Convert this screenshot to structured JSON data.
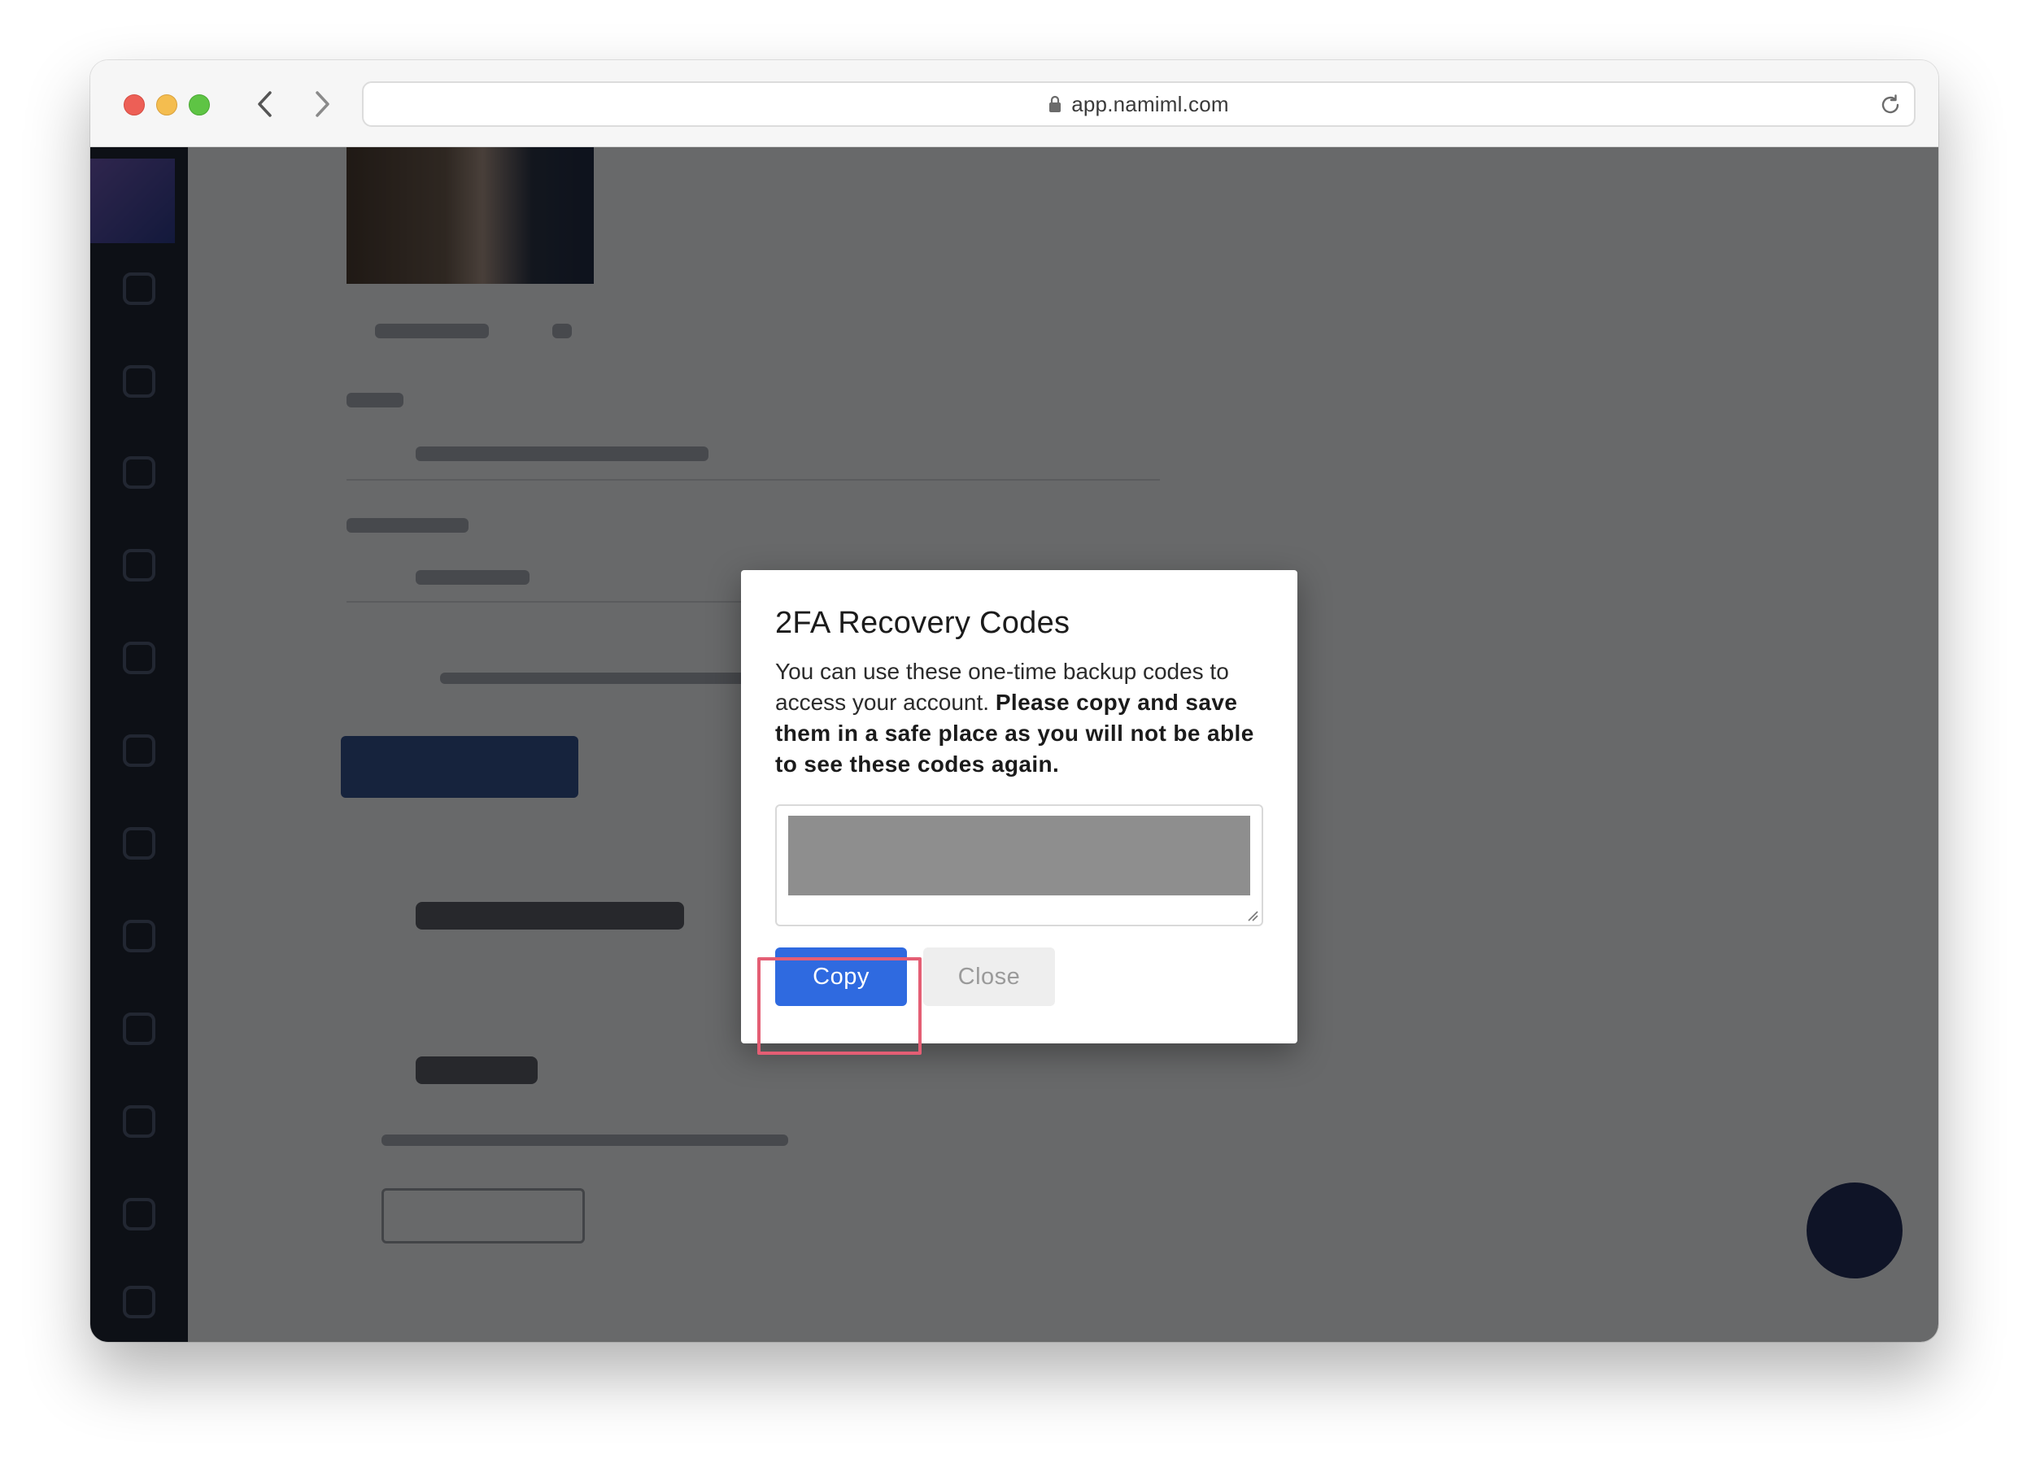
{
  "browser": {
    "url": "app.namiml.com",
    "traffic_lights": {
      "close": "#ed5f56",
      "minimize": "#f4bd4f",
      "zoom": "#5ec444"
    }
  },
  "dialog": {
    "title": "2FA Recovery Codes",
    "body_plain": "You can use these one-time backup codes to access your account.",
    "body_bold": "Please copy and save them in a safe place as you will not be able to see these codes again.",
    "codes_value": "",
    "copy_label": "Copy",
    "close_label": "Close"
  },
  "colors": {
    "primary_button": "#2f6ae0",
    "secondary_button": "#eeeeee",
    "highlight": "#e45e74",
    "overlay": "rgba(0,0,0,0.57)"
  },
  "icons": {
    "back": "chevron-left-icon",
    "forward": "chevron-right-icon",
    "lock": "lock-icon",
    "reload": "reload-icon",
    "chat": "chat-icon"
  }
}
